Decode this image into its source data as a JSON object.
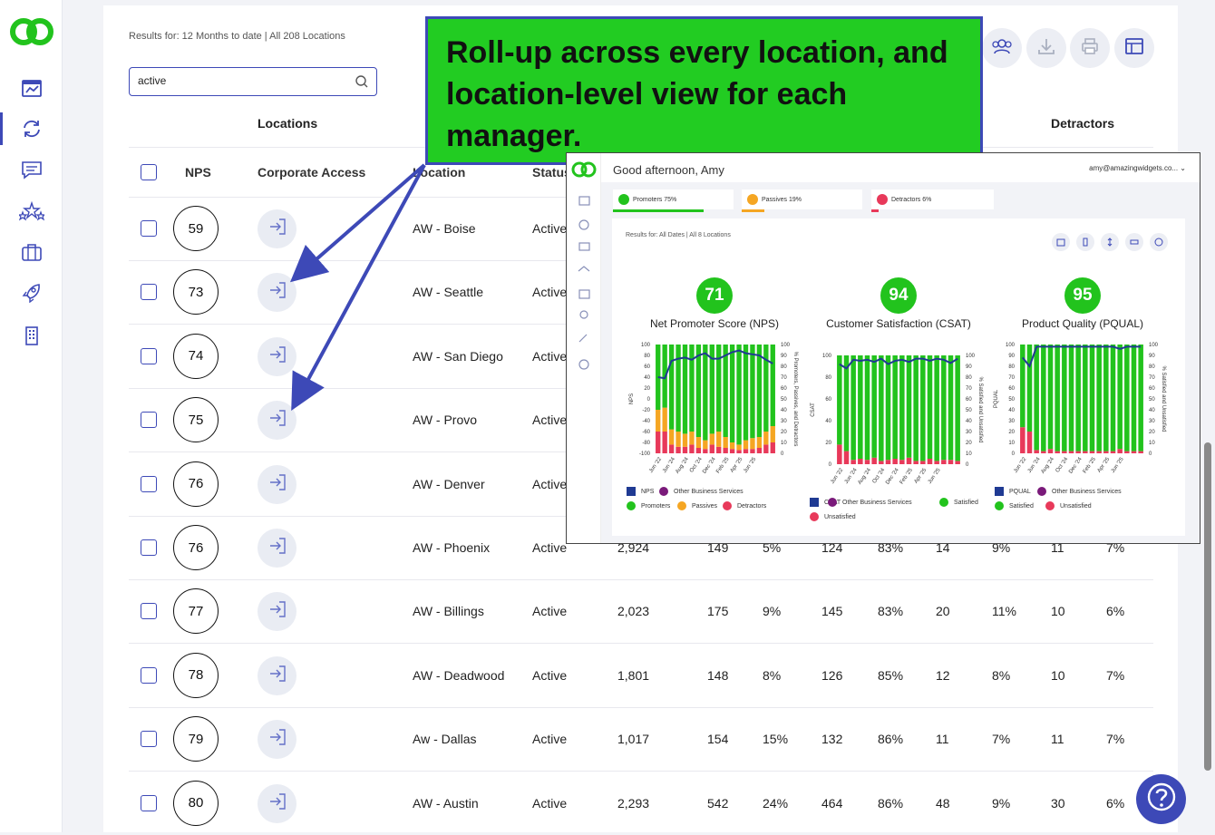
{
  "sidebar": {
    "logo": "app-logo",
    "items": [
      "dashboard-icon",
      "refresh-icon",
      "message-icon",
      "stars-icon",
      "briefcase-icon",
      "rocket-icon",
      "building-icon"
    ],
    "active_index": 1
  },
  "results_text": "Results for: 12 Months to date | All 208 Locations",
  "search": {
    "value": "active"
  },
  "group_headers": {
    "locations": "Locations",
    "detractors": "Detractors"
  },
  "columns": {
    "nps": "NPS",
    "corporate_access": "Corporate Access",
    "location": "Location",
    "status": "Status"
  },
  "toolbar": [
    "users-icon",
    "download-icon",
    "print-icon",
    "layout-icon"
  ],
  "rows": [
    {
      "nps": "59",
      "location": "AW - Boise",
      "status": "Active",
      "c1": "",
      "c2": "",
      "c3": "",
      "c4": "",
      "c5": "",
      "c6": "",
      "c7": "",
      "c8": "",
      "c9": ""
    },
    {
      "nps": "73",
      "location": "AW - Seattle",
      "status": "Active",
      "c1": "",
      "c2": "",
      "c3": "",
      "c4": "",
      "c5": "",
      "c6": "",
      "c7": "",
      "c8": "",
      "c9": ""
    },
    {
      "nps": "74",
      "location": "AW - San Diego",
      "status": "Active",
      "c1": "",
      "c2": "",
      "c3": "",
      "c4": "",
      "c5": "",
      "c6": "",
      "c7": "",
      "c8": "",
      "c9": ""
    },
    {
      "nps": "75",
      "location": "AW - Provo",
      "status": "Active",
      "c1": "",
      "c2": "",
      "c3": "",
      "c4": "",
      "c5": "",
      "c6": "",
      "c7": "",
      "c8": "",
      "c9": ""
    },
    {
      "nps": "76",
      "location": "AW - Denver",
      "status": "Active",
      "c1": "",
      "c2": "",
      "c3": "",
      "c4": "",
      "c5": "",
      "c6": "",
      "c7": "",
      "c8": "",
      "c9": ""
    },
    {
      "nps": "76",
      "location": "AW - Phoenix",
      "status": "Active",
      "c1": "2,924",
      "c2": "149",
      "c3": "5%",
      "c4": "124",
      "c5": "83%",
      "c6": "14",
      "c7": "9%",
      "c8": "11",
      "c9": "7%"
    },
    {
      "nps": "77",
      "location": "AW - Billings",
      "status": "Active",
      "c1": "2,023",
      "c2": "175",
      "c3": "9%",
      "c4": "145",
      "c5": "83%",
      "c6": "20",
      "c7": "11%",
      "c8": "10",
      "c9": "6%"
    },
    {
      "nps": "78",
      "location": "AW - Deadwood",
      "status": "Active",
      "c1": "1,801",
      "c2": "148",
      "c3": "8%",
      "c4": "126",
      "c5": "85%",
      "c6": "12",
      "c7": "8%",
      "c8": "10",
      "c9": "7%"
    },
    {
      "nps": "79",
      "location": "Aw - Dallas",
      "status": "Active",
      "c1": "1,017",
      "c2": "154",
      "c3": "15%",
      "c4": "132",
      "c5": "86%",
      "c6": "11",
      "c7": "7%",
      "c8": "11",
      "c9": "7%"
    },
    {
      "nps": "80",
      "location": "AW - Austin",
      "status": "Active",
      "c1": "2,293",
      "c2": "542",
      "c3": "24%",
      "c4": "464",
      "c5": "86%",
      "c6": "48",
      "c7": "9%",
      "c8": "30",
      "c9": "6%"
    }
  ],
  "callout": {
    "text": "Roll-up across every location, and location-level view for each manager."
  },
  "inset": {
    "greeting": "Good afternoon, Amy",
    "email": "amy@amazingwidgets.co...",
    "pills": [
      {
        "label": "Promoters 75%",
        "color": "#22c31d",
        "fraction": 0.75
      },
      {
        "label": "Passives 19%",
        "color": "#f5a623",
        "fraction": 0.19
      },
      {
        "label": "Detractors 6%",
        "color": "#e8395a",
        "fraction": 0.06
      }
    ],
    "results_text": "Results for: All Dates | All 8 Locations",
    "metrics": [
      {
        "score": "71",
        "title": "Net Promoter Score (NPS)",
        "left_axis": "NPS",
        "right_axis": "% Promoters, Passives, and Detractors",
        "legend": [
          {
            "label": "NPS",
            "color": "#1f3a93",
            "shape": "square"
          },
          {
            "label": "Other Business Services",
            "color": "#7a1a7a",
            "shape": "circle"
          },
          {
            "label": "Promoters",
            "color": "#22c31d",
            "shape": "circle"
          },
          {
            "label": "Passives",
            "color": "#f5a623",
            "shape": "circle"
          },
          {
            "label": "Detractors",
            "color": "#e8395a",
            "shape": "circle"
          }
        ]
      },
      {
        "score": "94",
        "title": "Customer Satisfaction (CSAT)",
        "left_axis": "CSAT",
        "right_axis": "% Satisfied and Unsatisfied",
        "legend": [
          {
            "label": "CSAT",
            "color": "#1f3a93",
            "shape": "square"
          },
          {
            "label": "Other Business Services",
            "color": "#7a1a7a",
            "shape": "circle"
          },
          {
            "label": "Satisfied",
            "color": "#22c31d",
            "shape": "circle"
          },
          {
            "label": "Unsatisfied",
            "color": "#e8395a",
            "shape": "circle"
          }
        ]
      },
      {
        "score": "95",
        "title": "Product Quality (PQUAL)",
        "left_axis": "PQUAL",
        "right_axis": "% Satisfied and Unsatisfied",
        "legend": [
          {
            "label": "PQUAL",
            "color": "#1f3a93",
            "shape": "square"
          },
          {
            "label": "Other Business Services",
            "color": "#7a1a7a",
            "shape": "circle"
          },
          {
            "label": "Satisfied",
            "color": "#22c31d",
            "shape": "circle"
          },
          {
            "label": "Unsatisfied",
            "color": "#e8395a",
            "shape": "circle"
          }
        ]
      }
    ],
    "x_ticks": [
      "Jun '22",
      "Jun '24",
      "Aug '24",
      "Oct '24",
      "Dec '24",
      "Feb '25",
      "Apr '25",
      "Jun '25"
    ]
  },
  "chart_data": [
    {
      "type": "bar",
      "title": "Net Promoter Score (NPS)",
      "ylabel": "NPS",
      "ylim": [
        -100,
        100
      ],
      "y2label": "% Promoters, Passives, and Detractors",
      "y2lim": [
        0,
        100
      ],
      "x": [
        "Jun '22",
        "",
        "Jun '24",
        "",
        "Aug '24",
        "",
        "Oct '24",
        "",
        "Dec '24",
        "",
        "Feb '25",
        "",
        "Apr '25",
        "",
        "Jun '25",
        "",
        "",
        ""
      ],
      "series": [
        {
          "name": "Promoters",
          "values": [
            60,
            58,
            78,
            80,
            82,
            80,
            85,
            88,
            82,
            80,
            85,
            90,
            92,
            88,
            86,
            85,
            80,
            75
          ]
        },
        {
          "name": "Passives",
          "values": [
            20,
            22,
            14,
            14,
            12,
            12,
            10,
            8,
            10,
            14,
            10,
            6,
            5,
            8,
            10,
            10,
            12,
            15
          ]
        },
        {
          "name": "Detractors",
          "values": [
            20,
            20,
            8,
            6,
            6,
            8,
            5,
            4,
            8,
            6,
            5,
            4,
            3,
            4,
            4,
            5,
            8,
            10
          ]
        },
        {
          "name": "NPS",
          "values": [
            40,
            38,
            70,
            74,
            76,
            72,
            80,
            84,
            74,
            74,
            80,
            86,
            89,
            84,
            82,
            80,
            72,
            65
          ]
        }
      ]
    },
    {
      "type": "bar",
      "title": "Customer Satisfaction (CSAT)",
      "ylabel": "CSAT",
      "ylim": [
        0,
        100
      ],
      "y2label": "% Satisfied and Unsatisfied",
      "y2lim": [
        0,
        100
      ],
      "x": [
        "Jun '22",
        "",
        "Jun '24",
        "",
        "Aug '24",
        "",
        "Oct '24",
        "",
        "Dec '24",
        "",
        "Feb '25",
        "",
        "Apr '25",
        "",
        "Jun '25",
        "",
        "",
        ""
      ],
      "series": [
        {
          "name": "Satisfied",
          "values": [
            82,
            88,
            96,
            95,
            96,
            94,
            97,
            96,
            95,
            96,
            94,
            97,
            97,
            95,
            97,
            96,
            96,
            97
          ]
        },
        {
          "name": "Unsatisfied",
          "values": [
            18,
            12,
            4,
            5,
            4,
            6,
            3,
            4,
            5,
            4,
            6,
            3,
            3,
            5,
            3,
            4,
            4,
            3
          ]
        },
        {
          "name": "CSAT",
          "values": [
            92,
            88,
            96,
            95,
            96,
            94,
            97,
            92,
            95,
            96,
            94,
            97,
            97,
            95,
            97,
            96,
            93,
            97
          ]
        }
      ]
    },
    {
      "type": "bar",
      "title": "Product Quality (PQUAL)",
      "ylabel": "PQUAL",
      "ylim": [
        0,
        100
      ],
      "y2label": "% Satisfied and Unsatisfied",
      "y2lim": [
        0,
        100
      ],
      "x": [
        "Jun '22",
        "",
        "Jun '24",
        "",
        "Aug '24",
        "",
        "Oct '24",
        "",
        "Dec '24",
        "",
        "Feb '25",
        "",
        "Apr '25",
        "",
        "Jun '25",
        "",
        "",
        ""
      ],
      "series": [
        {
          "name": "Satisfied",
          "values": [
            76,
            80,
            97,
            98,
            96,
            98,
            98,
            98,
            98,
            98,
            98,
            98,
            98,
            98,
            96,
            98,
            98,
            98
          ]
        },
        {
          "name": "Unsatisfied",
          "values": [
            24,
            20,
            3,
            2,
            4,
            2,
            2,
            2,
            2,
            2,
            2,
            2,
            2,
            2,
            4,
            2,
            2,
            2
          ]
        },
        {
          "name": "PQUAL",
          "values": [
            88,
            80,
            98,
            98,
            98,
            98,
            98,
            98,
            98,
            98,
            98,
            98,
            98,
            98,
            96,
            98,
            98,
            98
          ]
        }
      ]
    }
  ]
}
